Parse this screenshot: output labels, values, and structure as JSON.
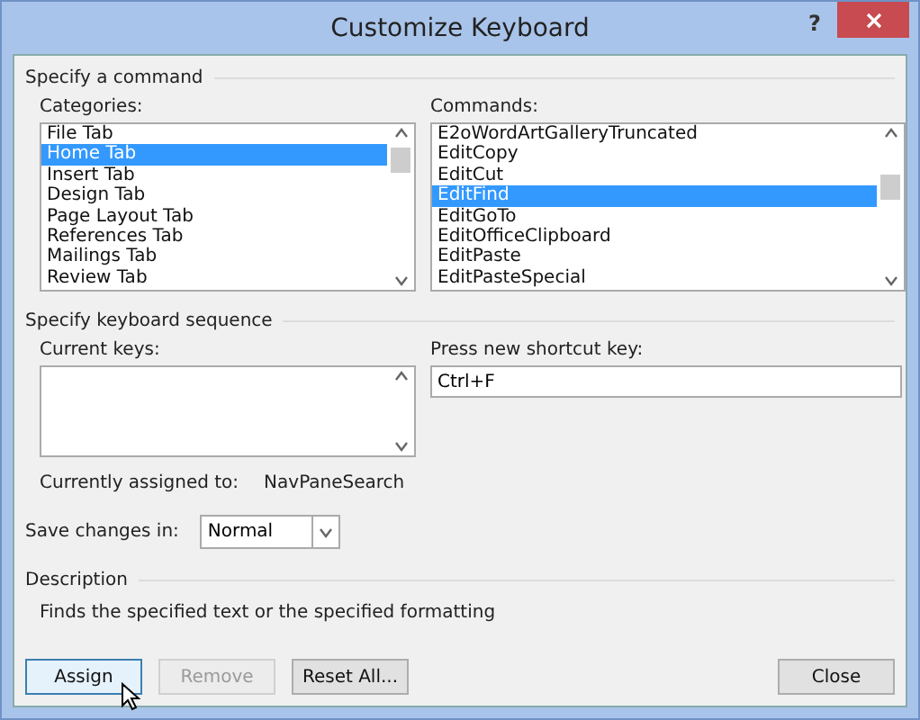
{
  "window": {
    "title": "Customize Keyboard",
    "help": "?"
  },
  "command_group": {
    "title": "Specify a command",
    "categories": {
      "label": "Categories:",
      "items": [
        {
          "label": "File Tab",
          "selected": false
        },
        {
          "label": "Home Tab",
          "selected": true
        },
        {
          "label": "Insert Tab",
          "selected": false
        },
        {
          "label": "Design Tab",
          "selected": false
        },
        {
          "label": "Page Layout Tab",
          "selected": false
        },
        {
          "label": "References Tab",
          "selected": false
        },
        {
          "label": "Mailings Tab",
          "selected": false
        },
        {
          "label": "Review Tab",
          "selected": false
        }
      ]
    },
    "commands": {
      "label": "Commands:",
      "items": [
        {
          "label": "E2oWordArtGalleryTruncated",
          "selected": false
        },
        {
          "label": "EditCopy",
          "selected": false
        },
        {
          "label": "EditCut",
          "selected": false
        },
        {
          "label": "EditFind",
          "selected": true
        },
        {
          "label": "EditGoTo",
          "selected": false
        },
        {
          "label": "EditOfficeClipboard",
          "selected": false
        },
        {
          "label": "EditPaste",
          "selected": false
        },
        {
          "label": "EditPasteSpecial",
          "selected": false
        }
      ]
    }
  },
  "sequence_group": {
    "title": "Specify keyboard sequence",
    "current_keys_label": "Current keys:",
    "new_key_label": "Press new shortcut key:",
    "new_key_value": "Ctrl+F",
    "assigned_label": "Currently assigned to:",
    "assigned_value": "NavPaneSearch"
  },
  "save_changes": {
    "label": "Save changes in:",
    "value": "Normal"
  },
  "description": {
    "title": "Description",
    "text": "Finds the specified text or the specified formatting"
  },
  "buttons": [
    {
      "label": "Assign",
      "disabled": false,
      "default": true
    },
    {
      "label": "Remove",
      "disabled": true,
      "default": false
    },
    {
      "label": "Reset All...",
      "disabled": false,
      "default": false
    },
    {
      "label": "Close",
      "disabled": false,
      "default": false
    }
  ]
}
